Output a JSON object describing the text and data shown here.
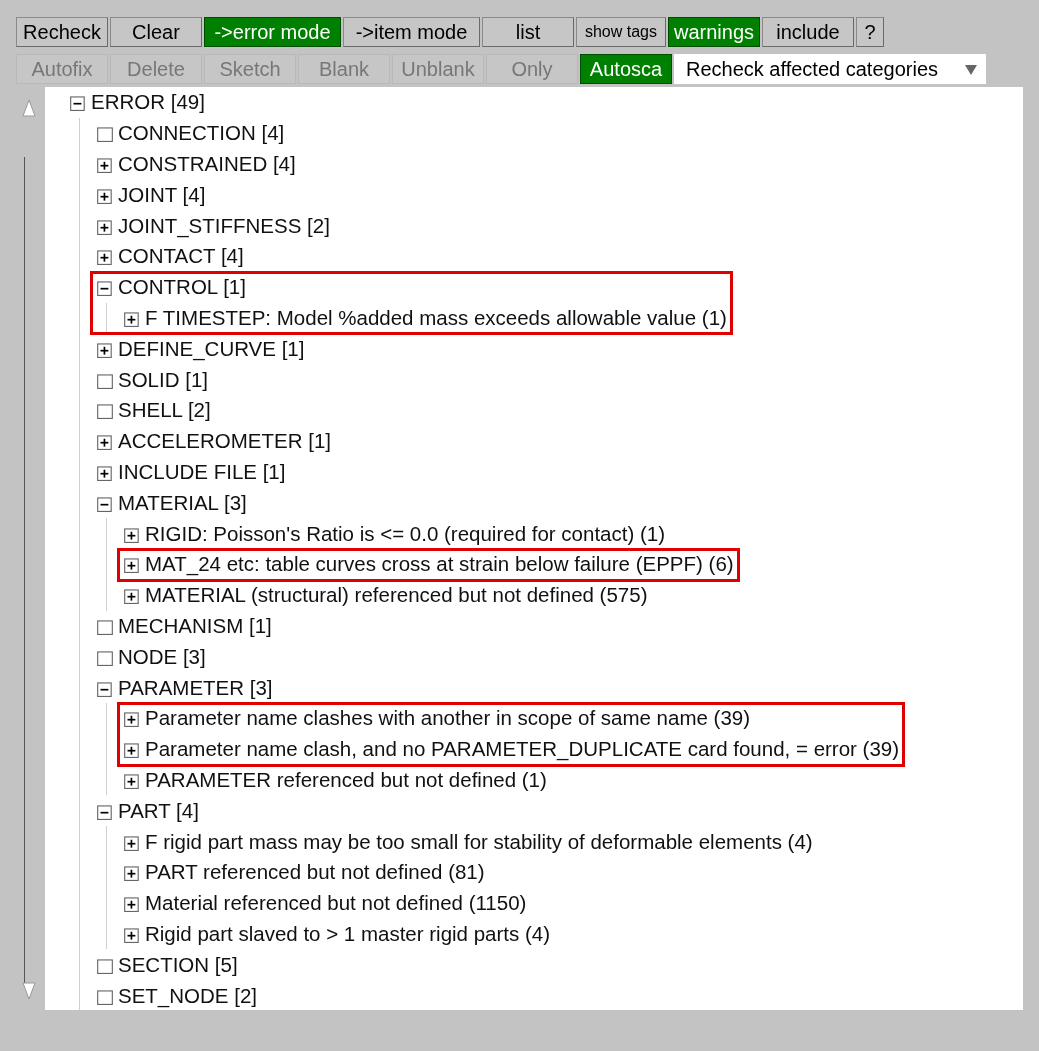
{
  "toolbar": {
    "buttons": [
      {
        "label": "Recheck",
        "on": false,
        "kind": "normal"
      },
      {
        "label": "Clear",
        "on": false,
        "kind": "normal"
      },
      {
        "label": "->error mode",
        "on": true,
        "kind": "normal"
      },
      {
        "label": "->item mode",
        "on": false,
        "kind": "normal"
      },
      {
        "label": "list",
        "on": false,
        "kind": "normal"
      },
      {
        "label": "show tags",
        "on": false,
        "kind": "small"
      },
      {
        "label": "warnings",
        "on": true,
        "kind": "normal"
      },
      {
        "label": "include",
        "on": false,
        "kind": "normal"
      },
      {
        "label": "?",
        "on": false,
        "kind": "normal"
      }
    ]
  },
  "action_bar": {
    "buttons": [
      {
        "label": "Autofix",
        "on": false,
        "disabled": true
      },
      {
        "label": "Delete",
        "on": false,
        "disabled": true
      },
      {
        "label": "Sketch",
        "on": false,
        "disabled": true
      },
      {
        "label": "Blank",
        "on": false,
        "disabled": true
      },
      {
        "label": "Unblank",
        "on": false,
        "disabled": true
      },
      {
        "label": "Only",
        "on": false,
        "disabled": true
      },
      {
        "label": "Autosca",
        "on": true,
        "disabled": false
      }
    ],
    "dropdown": {
      "value": "Recheck affected categories"
    }
  },
  "tree": {
    "label": "ERROR [49]",
    "kind": "folder",
    "expanded": true,
    "highlighted": false,
    "children": [
      {
        "label": "CONNECTION [4]",
        "kind": "empty",
        "highlighted": false
      },
      {
        "label": "CONSTRAINED [4]",
        "kind": "folder",
        "expanded": false,
        "highlighted": false
      },
      {
        "label": "JOINT [4]",
        "kind": "folder",
        "expanded": false,
        "highlighted": false
      },
      {
        "label": "JOINT_STIFFNESS [2]",
        "kind": "folder",
        "expanded": false,
        "highlighted": false
      },
      {
        "label": "CONTACT [4]",
        "kind": "folder",
        "expanded": false,
        "highlighted": false
      },
      {
        "label": "CONTROL [1]",
        "kind": "folder",
        "expanded": true,
        "highlighted": true,
        "children": [
          {
            "label": "F TIMESTEP: Model %added mass exceeds allowable value (1)",
            "kind": "folder",
            "expanded": false,
            "highlighted": true
          }
        ]
      },
      {
        "label": "DEFINE_CURVE [1]",
        "kind": "folder",
        "expanded": false,
        "highlighted": false
      },
      {
        "label": "SOLID [1]",
        "kind": "empty",
        "highlighted": false
      },
      {
        "label": "SHELL [2]",
        "kind": "empty",
        "highlighted": false
      },
      {
        "label": "ACCELEROMETER [1]",
        "kind": "folder",
        "expanded": false,
        "highlighted": false
      },
      {
        "label": "INCLUDE FILE [1]",
        "kind": "folder",
        "expanded": false,
        "highlighted": false
      },
      {
        "label": "MATERIAL [3]",
        "kind": "folder",
        "expanded": true,
        "highlighted": false,
        "children": [
          {
            "label": "RIGID: Poisson's Ratio is <= 0.0 (required for contact) (1)",
            "kind": "folder",
            "expanded": false,
            "highlighted": false
          },
          {
            "label": "MAT_24 etc: table curves cross at strain below failure (EPPF) (6)",
            "kind": "folder",
            "expanded": false,
            "highlighted": true
          },
          {
            "label": "MATERIAL (structural) referenced but not defined (575)",
            "kind": "folder",
            "expanded": false,
            "highlighted": false
          }
        ]
      },
      {
        "label": "MECHANISM [1]",
        "kind": "empty",
        "highlighted": false
      },
      {
        "label": "NODE [3]",
        "kind": "empty",
        "highlighted": false
      },
      {
        "label": "PARAMETER [3]",
        "kind": "folder",
        "expanded": true,
        "highlighted": false,
        "children": [
          {
            "label": "Parameter name clashes with another in scope of same name (39)",
            "kind": "folder",
            "expanded": false,
            "highlighted": true
          },
          {
            "label": "Parameter name clash, and no PARAMETER_DUPLICATE card found, = error (39)",
            "kind": "folder",
            "expanded": false,
            "highlighted": true
          },
          {
            "label": "PARAMETER referenced but not defined (1)",
            "kind": "folder",
            "expanded": false,
            "highlighted": false
          }
        ]
      },
      {
        "label": "PART [4]",
        "kind": "folder",
        "expanded": true,
        "highlighted": false,
        "children": [
          {
            "label": "F rigid part mass may be too small for stability of deformable elements (4)",
            "kind": "folder",
            "expanded": false,
            "highlighted": false
          },
          {
            "label": "PART referenced but not defined (81)",
            "kind": "folder",
            "expanded": false,
            "highlighted": false
          },
          {
            "label": "Material referenced but not defined (1150)",
            "kind": "folder",
            "expanded": false,
            "highlighted": false
          },
          {
            "label": "Rigid part slaved to > 1 master rigid parts (4)",
            "kind": "folder",
            "expanded": false,
            "highlighted": false
          }
        ]
      },
      {
        "label": "SECTION [5]",
        "kind": "empty",
        "highlighted": false
      },
      {
        "label": "SET_NODE [2]",
        "kind": "empty",
        "highlighted": false
      }
    ]
  }
}
